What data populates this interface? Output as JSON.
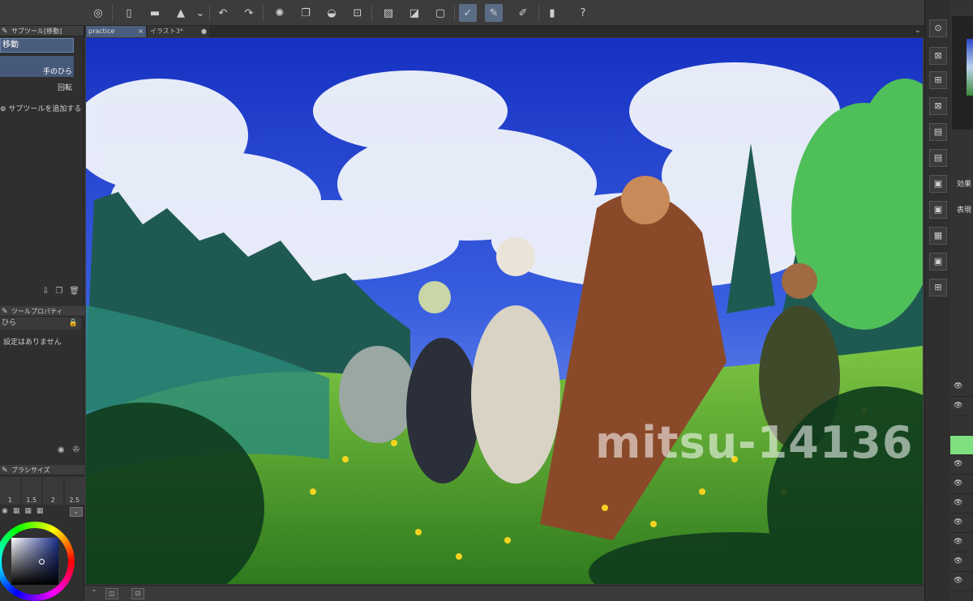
{
  "tabs": [
    {
      "label": "practice",
      "close": "×"
    },
    {
      "label": "イラスト3*",
      "close": "●"
    }
  ],
  "subtool_panel": {
    "title": "サブツール[移動]",
    "selected_tool": "移動",
    "items": [
      "手のひら",
      "回転"
    ],
    "add_label": "サブツールを追加する"
  },
  "tool_property": {
    "title": "ツールプロパティ",
    "tool_name": "ひら",
    "no_settings": "設定はありません"
  },
  "brush_size": {
    "title": "ブラシサイズ",
    "sizes": [
      "1",
      "1.5",
      "2",
      "2.5"
    ]
  },
  "color": {
    "main_color": "#1c2f8c"
  },
  "canvas": {
    "watermark": "mitsu-14136"
  },
  "right_panel": {
    "effect_label": "効果",
    "express_label": "表現"
  },
  "icons": {
    "top_bar": [
      "menu-icon",
      "new-file-icon",
      "open-folder-icon",
      "save-icon",
      "dropdown-icon",
      "undo-icon",
      "redo-icon",
      "loading-icon",
      "copy-icon",
      "fill-icon",
      "transform-icon",
      "deselect-icon",
      "gradient-icon",
      "border-icon",
      "pen-active-icon",
      "brush-active-icon",
      "correction-icon",
      "device-icon",
      "help-icon"
    ]
  }
}
